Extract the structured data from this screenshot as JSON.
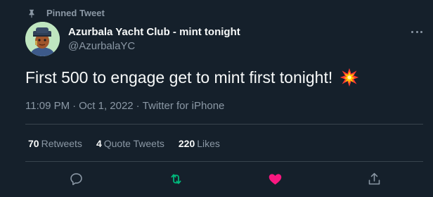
{
  "pinned": {
    "label": "Pinned Tweet"
  },
  "author": {
    "display_name": "Azurbala Yacht Club - mint tonight",
    "handle": "@AzurbalaYC"
  },
  "tweet": {
    "text": "First 500 to engage get to mint first tonight!",
    "emoji": "collision-emoji",
    "time": "11:09 PM",
    "date": "Oct 1, 2022",
    "source": "Twitter for iPhone"
  },
  "stats": {
    "retweets_count": "70",
    "retweets_label": "Retweets",
    "quotes_count": "4",
    "quotes_label": "Quote Tweets",
    "likes_count": "220",
    "likes_label": "Likes"
  },
  "actions": {
    "reply_icon": "reply-icon",
    "retweet_icon": "retweet-icon",
    "like_icon": "heart-icon",
    "share_icon": "share-icon"
  },
  "colors": {
    "background": "#15202b",
    "text_primary": "#f7f9f9",
    "text_secondary": "#8b98a5",
    "retweet_green": "#00ba7c",
    "like_pink": "#f91880",
    "divider": "#38444d"
  }
}
